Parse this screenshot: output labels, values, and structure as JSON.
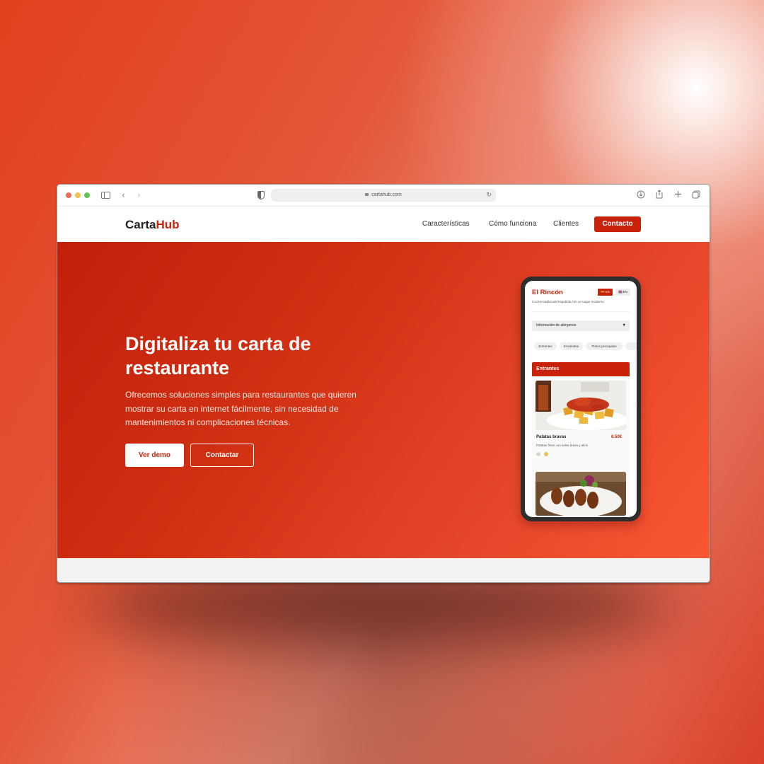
{
  "browser": {
    "url": "cartahub.com"
  },
  "site": {
    "logo_part1": "Carta",
    "logo_part2": "Hub",
    "nav": {
      "features": "Características",
      "how": "Cómo funciona",
      "clients": "Clientes",
      "contact": "Contacto"
    }
  },
  "hero": {
    "title": "Digitaliza tu carta de restaurante",
    "description": "Ofrecemos soluciones simples para restaurantes que quieren mostrar su carta en internet fácilmente, sin necesidad de mantenimientos ni complicaciones técnicas.",
    "primary_button": "Ver demo",
    "secondary_button": "Contactar"
  },
  "phone": {
    "restaurant_name": "El Rincón",
    "tagline": "Cocina tradicional española con un toque moderno",
    "lang_es": "ES",
    "lang_en": "EN",
    "allergen_label": "Información de alérgenos",
    "categories": [
      "Entrantes",
      "Ensaladas",
      "Platos principales"
    ],
    "section_title": "Entrantes",
    "dish": {
      "name": "Patatas bravas",
      "price": "6.50€",
      "description": "Patatas fritas con salsa brava y alioli"
    }
  },
  "colors": {
    "brand": "#c8220b",
    "hero_start": "#c2200a",
    "hero_end": "#f95632"
  }
}
